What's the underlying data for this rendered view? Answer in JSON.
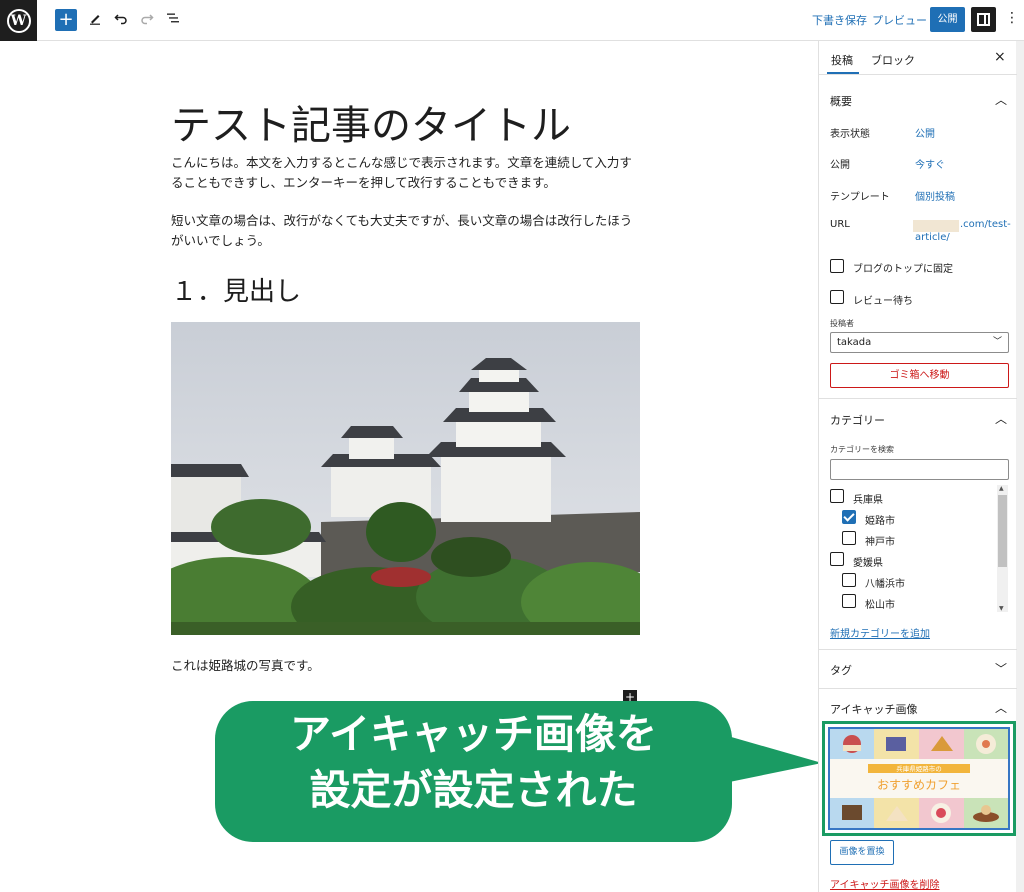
{
  "toolbar": {
    "logo": "W",
    "add_icon": "+",
    "draft_label": "下書き保存",
    "preview_label": "プレビュー",
    "publish_label": "公開",
    "more_icon": "⋮"
  },
  "editor": {
    "title": "テスト記事のタイトル",
    "paragraphs": [
      "こんにちは。本文を入力するとこんな感じで表示されます。文章を連続して入力することもできすし、エンターキーを押して改行することもできます。",
      "短い文章の場合は、改行がなくても大丈夫ですが、長い文章の場合は改行したほうがいいでしょう。"
    ],
    "heading": "１．見出し",
    "caption": "これは姫路城の写真です。"
  },
  "callout": {
    "line1": "アイキャッチ画像を",
    "line2": "設定が設定された"
  },
  "sidebar": {
    "tabs": [
      "投稿",
      "ブロック"
    ],
    "close_icon": "×",
    "summary": {
      "title": "概要",
      "rows": [
        {
          "label": "表示状態",
          "value": "公開"
        },
        {
          "label": "公開",
          "value": "今すぐ"
        },
        {
          "label": "テンプレート",
          "value": "個別投稿"
        }
      ],
      "url_label": "URL",
      "url_value_1": ".com/test-",
      "url_value_2": "article/",
      "sticky_label": "ブログのトップに固定",
      "pending_label": "レビュー待ち",
      "author_label": "投稿者",
      "author_value": "takada",
      "trash_label": "ゴミ箱へ移動"
    },
    "categories": {
      "title": "カテゴリー",
      "search_label": "カテゴリーを検索",
      "items": [
        {
          "label": "兵庫県",
          "checked": false
        },
        {
          "label": "姫路市",
          "checked": true
        },
        {
          "label": "神戸市",
          "checked": false
        },
        {
          "label": "愛媛県",
          "checked": false
        },
        {
          "label": "八幡浜市",
          "checked": false
        },
        {
          "label": "松山市",
          "checked": false
        }
      ],
      "add_link": "新規カテゴリーを追加"
    },
    "tags": {
      "title": "タグ"
    },
    "featured": {
      "title": "アイキャッチ画像",
      "banner_small": "兵庫県姫路市の",
      "banner_big": "おすすめカフェ",
      "replace_label": "画像を置換",
      "remove_link": "アイキャッチ画像を削除"
    }
  },
  "colors": {
    "accent": "#1f6fb5",
    "callout": "#1a9b63",
    "danger": "#cc1818"
  }
}
